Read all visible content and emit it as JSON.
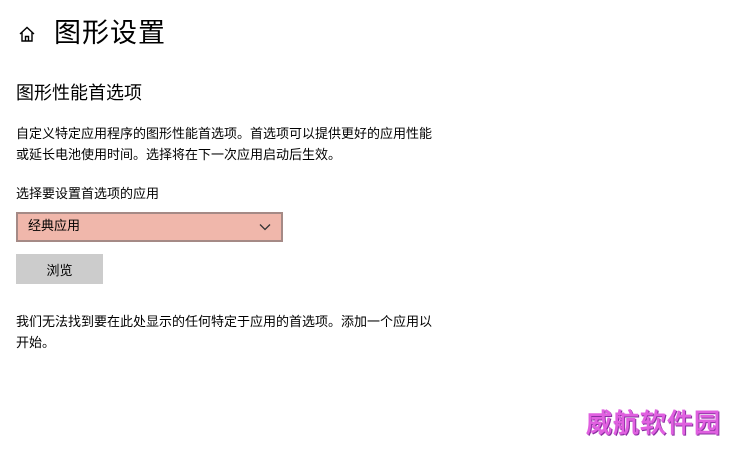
{
  "header": {
    "home_icon": "home-icon",
    "title": "图形设置"
  },
  "section": {
    "title": "图形性能首选项",
    "description": "自定义特定应用程序的图形性能首选项。首选项可以提供更好的应用性能或延长电池使用时间。选择将在下一次应用启动后生效。"
  },
  "app_select": {
    "label": "选择要设置首选项的应用",
    "value": "经典应用",
    "chevron_icon": "chevron-down-icon",
    "background": "#f0b7ab"
  },
  "browse_button": {
    "label": "浏览"
  },
  "empty_message": "我们无法找到要在此处显示的任何特定于应用的首选项。添加一个应用以开始。",
  "watermark": {
    "text": "威航软件园",
    "color": "#e060e0"
  }
}
